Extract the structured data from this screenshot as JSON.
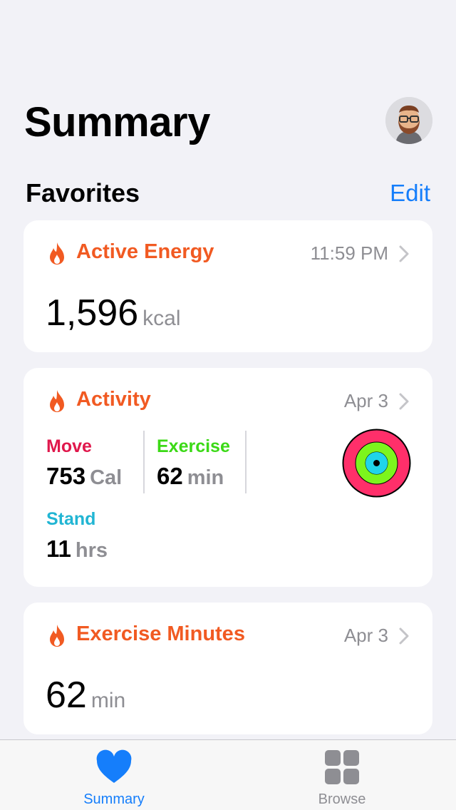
{
  "header": {
    "title": "Summary"
  },
  "favorites": {
    "title": "Favorites",
    "edit_label": "Edit"
  },
  "cards": {
    "active_energy": {
      "title": "Active Energy",
      "time": "11:59 PM",
      "value": "1,596",
      "unit": "kcal"
    },
    "activity": {
      "title": "Activity",
      "date": "Apr 3",
      "move": {
        "label": "Move",
        "value": "753",
        "unit": "Cal"
      },
      "exercise": {
        "label": "Exercise",
        "value": "62",
        "unit": "min"
      },
      "stand": {
        "label": "Stand",
        "value": "11",
        "unit": "hrs"
      }
    },
    "exercise_minutes": {
      "title": "Exercise Minutes",
      "date": "Apr 3",
      "value": "62",
      "unit": "min"
    }
  },
  "tabbar": {
    "summary_label": "Summary",
    "browse_label": "Browse"
  },
  "colors": {
    "accent": "#157efb",
    "flame": "#f15a22",
    "move": "#e0184c",
    "exercise": "#3bd916",
    "stand": "#21b5d3",
    "secondary": "#8e8e93"
  },
  "icons": [
    "avatar-memoji",
    "flame-icon",
    "chevron-right-icon",
    "activity-rings-icon",
    "heart-icon",
    "grid-icon"
  ]
}
